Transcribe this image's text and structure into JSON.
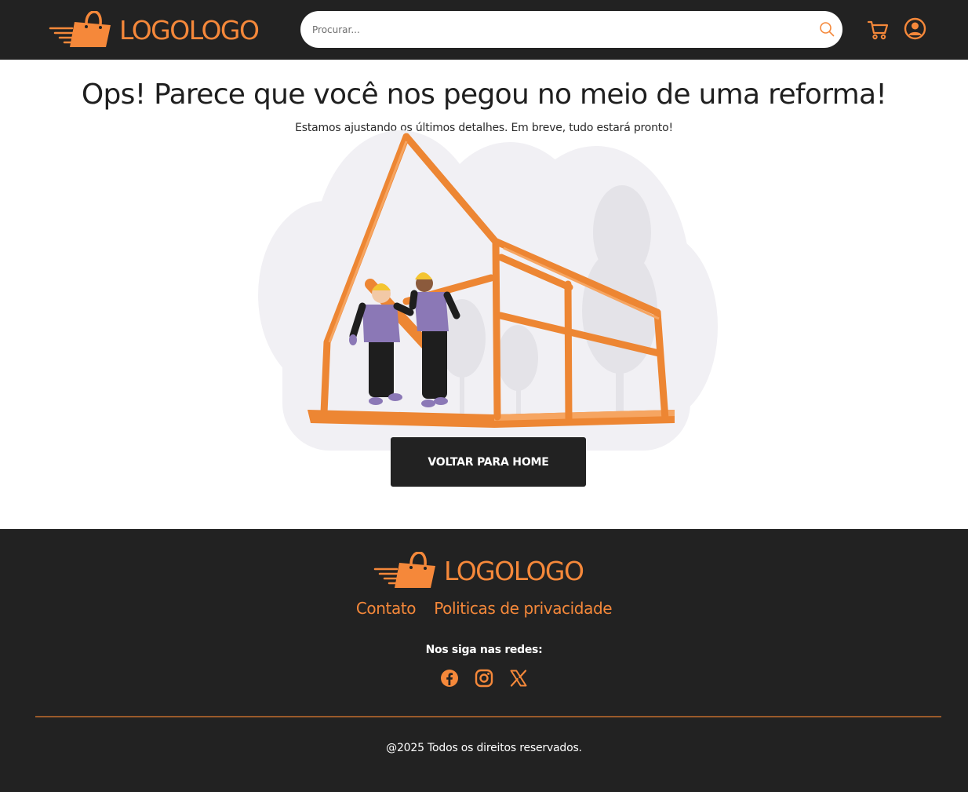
{
  "header": {
    "logo_text": "LOGOLOGO",
    "search": {
      "placeholder": "Procurar..."
    },
    "icons": [
      "logo-bag-icon",
      "search-icon",
      "cart-icon",
      "user-icon"
    ]
  },
  "main": {
    "title": "Ops! Parece que você nos pegou no meio de uma reforma!",
    "subtitle": "Estamos ajustando os últimos detalhes. Em breve, tudo estará pronto!",
    "home_button": "VOLTAR PARA HOME"
  },
  "footer": {
    "logo_text": "LOGOLOGO",
    "links": [
      {
        "label": "Contato"
      },
      {
        "label": "Politicas de privacidade"
      }
    ],
    "social_label": "Nos siga nas redes:",
    "social_icons": [
      "facebook-icon",
      "instagram-icon",
      "x-icon"
    ],
    "copyright": "@2025 Todos os direitos reservados."
  },
  "colors": {
    "dark": "#222222",
    "accent": "#f5883a",
    "text": "#1f1f1f",
    "background": "#ffffff"
  }
}
